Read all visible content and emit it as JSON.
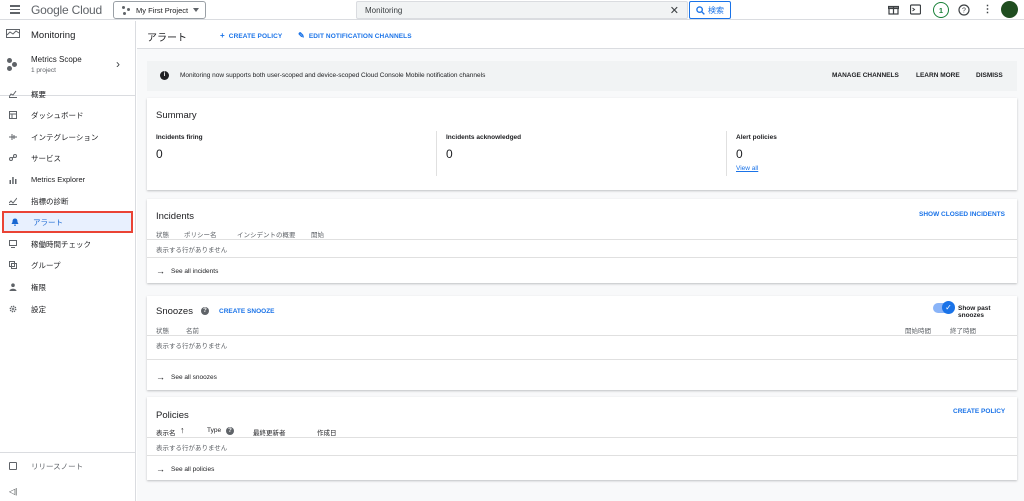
{
  "topbar": {
    "logo_google": "Google",
    "logo_cloud": "Cloud",
    "project": "My First Project",
    "search_value": "Monitoring",
    "search_button": "検索",
    "notification_count": "1"
  },
  "sidebar": {
    "title": "Monitoring",
    "scope_title": "Metrics Scope",
    "scope_sub": "1 project",
    "items": [
      {
        "label": "概要",
        "icon": "chart-area-icon"
      },
      {
        "label": "ダッシュボード",
        "icon": "dashboard-grid-icon"
      },
      {
        "label": "インテグレーション",
        "icon": "integration-icon"
      },
      {
        "label": "サービス",
        "icon": "services-icon"
      },
      {
        "label": "Metrics Explorer",
        "icon": "bar-chart-icon"
      },
      {
        "label": "指標の診断",
        "icon": "diagnostics-icon"
      },
      {
        "label": "アラート",
        "icon": "bell-icon"
      },
      {
        "label": "稼働時間チェック",
        "icon": "monitor-icon"
      },
      {
        "label": "グループ",
        "icon": "groups-icon"
      },
      {
        "label": "権限",
        "icon": "person-icon"
      },
      {
        "label": "設定",
        "icon": "gear-icon"
      }
    ],
    "release_notes": "リリースノート",
    "collapse": "◁|"
  },
  "main": {
    "title": "アラート",
    "create_policy": "CREATE POLICY",
    "edit_channels": "EDIT NOTIFICATION CHANNELS",
    "notice": {
      "text": "Monitoring now supports both user-scoped and device-scoped Cloud Console Mobile notification channels",
      "manage": "MANAGE CHANNELS",
      "learn": "LEARN MORE",
      "dismiss": "DISMISS"
    },
    "summary": {
      "title": "Summary",
      "firing_label": "Incidents firing",
      "firing_value": "0",
      "ack_label": "Incidents acknowledged",
      "ack_value": "0",
      "policies_label": "Alert policies",
      "policies_value": "0",
      "view_all": "View all"
    },
    "incidents": {
      "title": "Incidents",
      "show_closed": "SHOW CLOSED INCIDENTS",
      "columns": [
        "状態",
        "ポリシー名",
        "インシデントの概要",
        "開始"
      ],
      "empty": "表示する行がありません",
      "see_all": "See all incidents"
    },
    "snoozes": {
      "title": "Snoozes",
      "create": "CREATE SNOOZE",
      "show_past": "Show past snoozes",
      "show_past_on": true,
      "columns": [
        "状態",
        "名前",
        "開始時間",
        "終了時間"
      ],
      "empty": "表示する行がありません",
      "see_all": "See all snoozes"
    },
    "policies": {
      "title": "Policies",
      "create": "CREATE POLICY",
      "columns": [
        "表示名",
        "Type",
        "最終更新者",
        "作成日"
      ],
      "empty": "表示する行がありません",
      "see_all": "See all policies"
    }
  },
  "colors": {
    "accent": "#1a73e8",
    "highlight_border": "#ea4335",
    "active_bg": "#e8f0fe"
  }
}
